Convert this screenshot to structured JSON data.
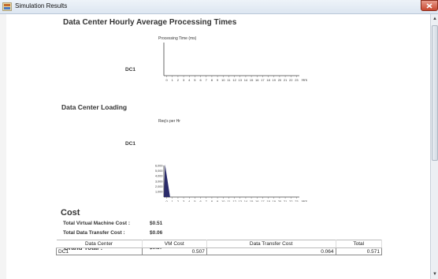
{
  "window": {
    "title": "Simulation Results",
    "close_icon": "close-x-icon",
    "app_icon": "java-app-icon"
  },
  "processing": {
    "heading": "Data Center Hourly Average Processing Times",
    "row_label": "DC1",
    "chart_data": {
      "type": "bar",
      "title": "Processing Time (ms)",
      "xlabel": "Hrs",
      "categories": [
        "0",
        "1",
        "2",
        "3",
        "4",
        "5",
        "6",
        "7",
        "8",
        "9",
        "10",
        "11",
        "12",
        "13",
        "14",
        "15",
        "16",
        "17",
        "18",
        "19",
        "20",
        "21",
        "22",
        "23"
      ],
      "series": [
        {
          "values": [
            0,
            0,
            0,
            0,
            0,
            0,
            0,
            0,
            0,
            0,
            0,
            0,
            0,
            0,
            0,
            0,
            0,
            0,
            0,
            0,
            0,
            0,
            0,
            0
          ]
        }
      ]
    }
  },
  "loading": {
    "heading": "Data Center Loading",
    "row_label": "DC1",
    "chart_data": {
      "type": "bar",
      "title": "Req's per Hr",
      "xlabel": "Hrs",
      "ylim": [
        0,
        6000
      ],
      "yticks": [
        "6,000",
        "5,000",
        "4,000",
        "3,000",
        "2,000",
        "1,000"
      ],
      "categories": [
        "0",
        "1",
        "2",
        "3",
        "4",
        "5",
        "6",
        "7",
        "8",
        "9",
        "10",
        "11",
        "12",
        "13",
        "14",
        "15",
        "16",
        "17",
        "18",
        "19",
        "20",
        "21",
        "22",
        "23"
      ],
      "color": "#2b2c6b",
      "series": [
        {
          "values": [
            6200,
            0,
            0,
            0,
            0,
            0,
            0,
            0,
            0,
            0,
            0,
            0,
            0,
            0,
            0,
            0,
            0,
            0,
            0,
            0,
            0,
            0,
            0,
            0
          ]
        }
      ]
    }
  },
  "cost": {
    "heading": "Cost",
    "vm_label": "Total Virtual Machine Cost :",
    "vm_value": "$0.51",
    "dt_label": "Total Data Transfer Cost :",
    "dt_value": "$0.06",
    "grand_label": "Grand Total :",
    "grand_value": "$0.57",
    "table": {
      "headers": [
        "Data Center",
        "VM Cost",
        "Data Transfer Cost",
        "Total"
      ],
      "rows": [
        [
          "DC1",
          "0.507",
          "0.064",
          "0.571"
        ]
      ]
    }
  }
}
